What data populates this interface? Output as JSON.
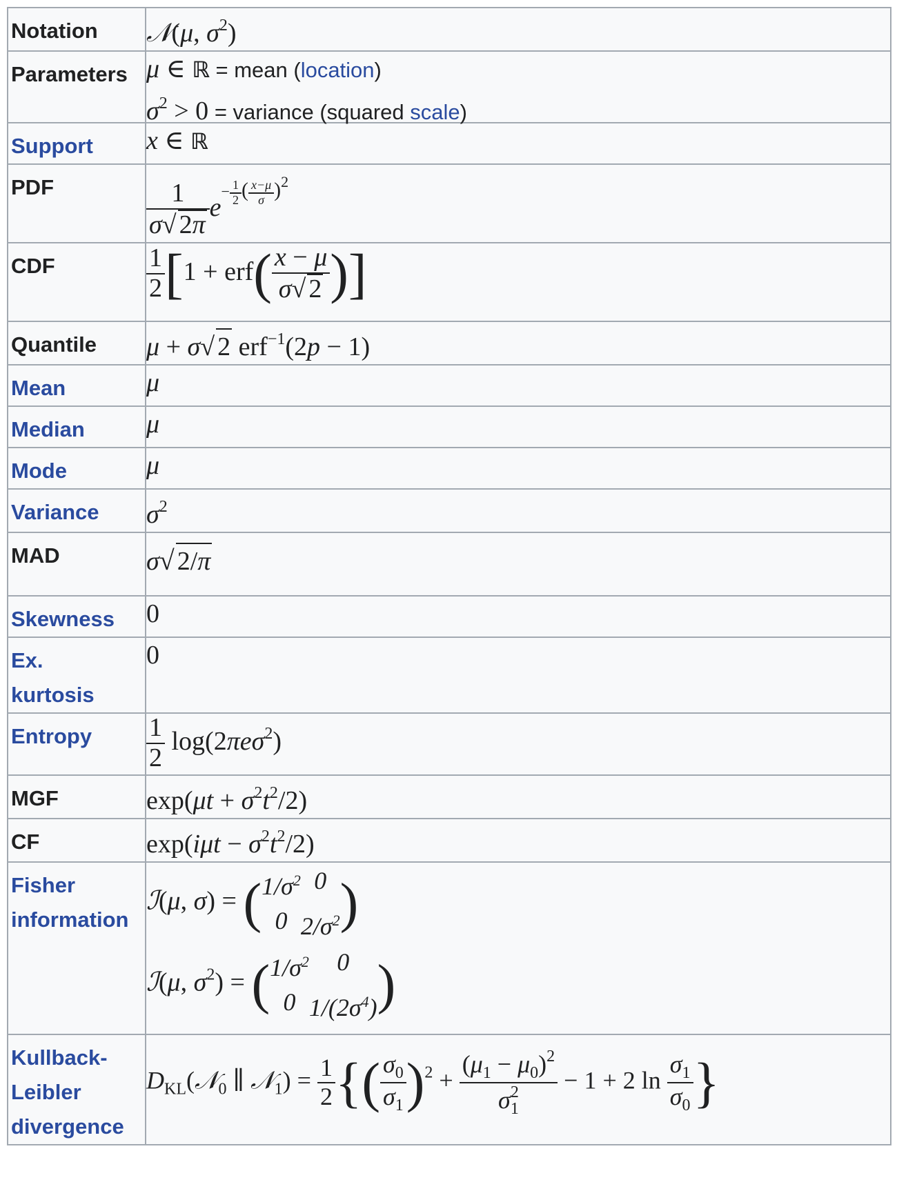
{
  "rows": {
    "notation": {
      "label": "Notation"
    },
    "parameters": {
      "label": "Parameters",
      "mean_eq": "= mean (",
      "location": "location",
      "close": ")",
      "var_eq": "= variance (squared",
      "scale": "scale",
      "close2": ")"
    },
    "support": {
      "label": "Support"
    },
    "pdf": {
      "label": "PDF"
    },
    "cdf": {
      "label": "CDF"
    },
    "quantile": {
      "label": "Quantile"
    },
    "mean": {
      "label": "Mean"
    },
    "median": {
      "label": "Median"
    },
    "mode": {
      "label": "Mode"
    },
    "variance": {
      "label": "Variance"
    },
    "mad": {
      "label": "MAD"
    },
    "skewness": {
      "label": "Skewness",
      "value": "0"
    },
    "kurtosis": {
      "label_1": "Ex.",
      "label_2": "kurtosis",
      "value": "0"
    },
    "entropy": {
      "label": "Entropy"
    },
    "mgf": {
      "label": "MGF"
    },
    "cf": {
      "label": "CF"
    },
    "fisher": {
      "label_1": "Fisher",
      "label_2": "information"
    },
    "kl": {
      "label_1": "Kullback-",
      "label_2": "Leibler",
      "label_3": "divergence"
    }
  },
  "colors": {
    "link": "#2a4b9f",
    "border": "#a2a9b1",
    "background": "#f8f9fa"
  }
}
